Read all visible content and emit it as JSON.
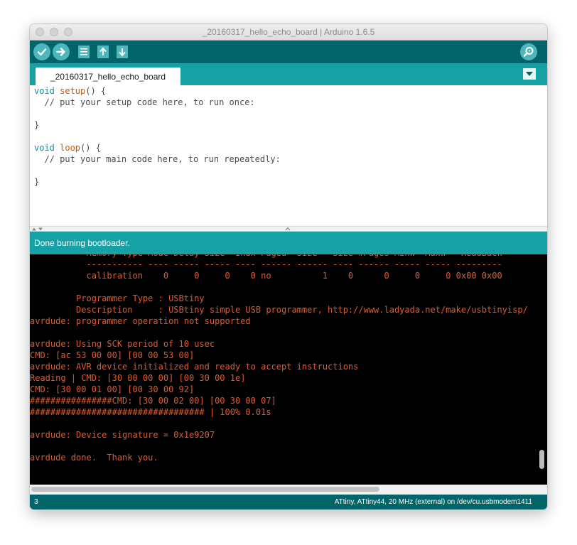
{
  "window": {
    "title": "_20160317_hello_echo_board | Arduino 1.6.5"
  },
  "toolbar": {
    "buttons": [
      {
        "name": "verify",
        "icon": "check-icon"
      },
      {
        "name": "upload",
        "icon": "arrow-right-icon"
      },
      {
        "name": "new",
        "icon": "document-icon"
      },
      {
        "name": "open",
        "icon": "arrow-up-icon"
      },
      {
        "name": "save",
        "icon": "arrow-down-icon"
      }
    ],
    "serial_monitor_icon": "magnifier-icon"
  },
  "tabs": [
    {
      "label": "_20160317_hello_echo_board",
      "active": true
    }
  ],
  "editor": {
    "lines": [
      [
        {
          "t": "void ",
          "c": "kw"
        },
        {
          "t": "setup",
          "c": "fn"
        },
        {
          "t": "() {",
          "c": ""
        }
      ],
      [
        {
          "t": "  // put your setup code here, to run once:",
          "c": "cm"
        }
      ],
      [
        {
          "t": "",
          "c": ""
        }
      ],
      [
        {
          "t": "}",
          "c": ""
        }
      ],
      [
        {
          "t": "",
          "c": ""
        }
      ],
      [
        {
          "t": "void ",
          "c": "kw"
        },
        {
          "t": "loop",
          "c": "fn"
        },
        {
          "t": "() {",
          "c": ""
        }
      ],
      [
        {
          "t": "  // put your main code here, to run repeatedly:",
          "c": "cm"
        }
      ],
      [
        {
          "t": "",
          "c": ""
        }
      ],
      [
        {
          "t": "}",
          "c": ""
        }
      ]
    ]
  },
  "status": {
    "message": "Done burning bootloader."
  },
  "console": {
    "lines": [
      "           Memory Type Mode Delay Size  Indx Paged  Size   Size #Pages MinW  MaxW   ReadBack",
      "           ----------- ---- ----- ----- ---- ------ ------ ---- ------ ----- ----- ---------",
      "           calibration    0     0     0    0 no          1    0      0     0     0 0x00 0x00",
      "",
      "         Programmer Type : USBtiny",
      "         Description     : USBtiny simple USB programmer, http://www.ladyada.net/make/usbtinyisp/",
      "avrdude: programmer operation not supported",
      "",
      "avrdude: Using SCK period of 10 usec",
      "CMD: [ac 53 00 00] [00 00 53 00]",
      "avrdude: AVR device initialized and ready to accept instructions",
      "Reading | CMD: [30 00 00 00] [00 30 00 1e]",
      "CMD: [30 00 01 00] [00 30 00 92]",
      "################CMD: [30 00 02 00] [00 30 00 07]",
      "################################## | 100% 0.01s",
      "",
      "avrdude: Device signature = 0x1e9207",
      "",
      "avrdude done.  Thank you.",
      ""
    ]
  },
  "footer": {
    "line_number": "3",
    "board": "ATtiny, ATtiny44, 20 MHz (external) on /dev/cu.usbmodem1411"
  }
}
